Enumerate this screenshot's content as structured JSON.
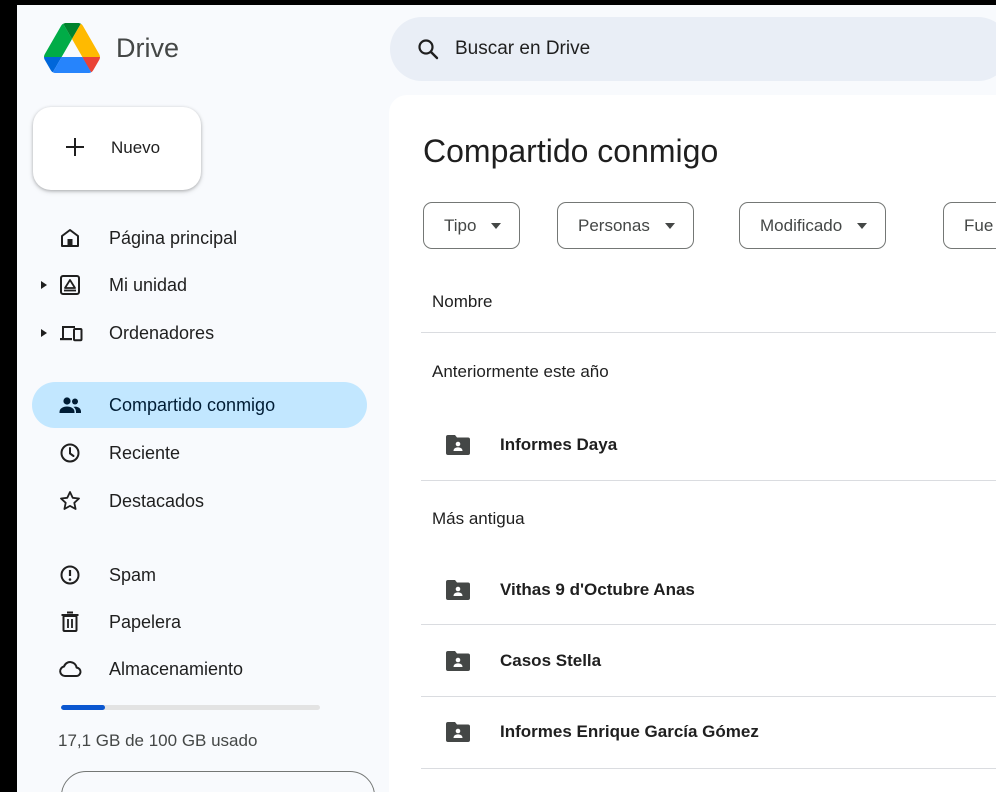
{
  "app": {
    "logo_text": "Drive"
  },
  "search": {
    "placeholder": "Buscar en Drive"
  },
  "new_button": {
    "label": "Nuevo"
  },
  "sidebar": {
    "items": [
      {
        "label": "Página principal",
        "icon": "home-icon"
      },
      {
        "label": "Mi unidad",
        "icon": "my-drive-icon"
      },
      {
        "label": "Ordenadores",
        "icon": "computers-icon"
      },
      {
        "label": "Compartido conmigo",
        "icon": "shared-people-icon",
        "active": true
      },
      {
        "label": "Reciente",
        "icon": "clock-icon"
      },
      {
        "label": "Destacados",
        "icon": "star-icon"
      },
      {
        "label": "Spam",
        "icon": "spam-icon"
      },
      {
        "label": "Papelera",
        "icon": "trash-icon"
      },
      {
        "label": "Almacenamiento",
        "icon": "cloud-icon"
      }
    ],
    "storage": {
      "used_text": "17,1 GB de 100 GB usado",
      "used_fraction": 0.171,
      "accent": "#0b57d0"
    }
  },
  "main": {
    "title": "Compartido conmigo",
    "filters": [
      {
        "label": "Tipo"
      },
      {
        "label": "Personas"
      },
      {
        "label": "Modificado"
      },
      {
        "label": "Fue"
      }
    ],
    "column_header": "Nombre",
    "sections": [
      {
        "label": "Anteriormente este año",
        "rows": [
          {
            "name": "Informes Daya",
            "icon": "shared-folder-icon"
          }
        ]
      },
      {
        "label": "Más antigua",
        "rows": [
          {
            "name": "Vithas 9 d'Octubre Anas",
            "icon": "shared-folder-icon"
          },
          {
            "name": "Casos Stella",
            "icon": "shared-folder-icon"
          },
          {
            "name": "Informes Enrique García Gómez",
            "icon": "shared-folder-icon"
          }
        ]
      }
    ]
  },
  "colors": {
    "active_nav_bg": "#c2e7ff",
    "search_bg": "#e9eef6",
    "app_bg": "#f8fafd"
  }
}
